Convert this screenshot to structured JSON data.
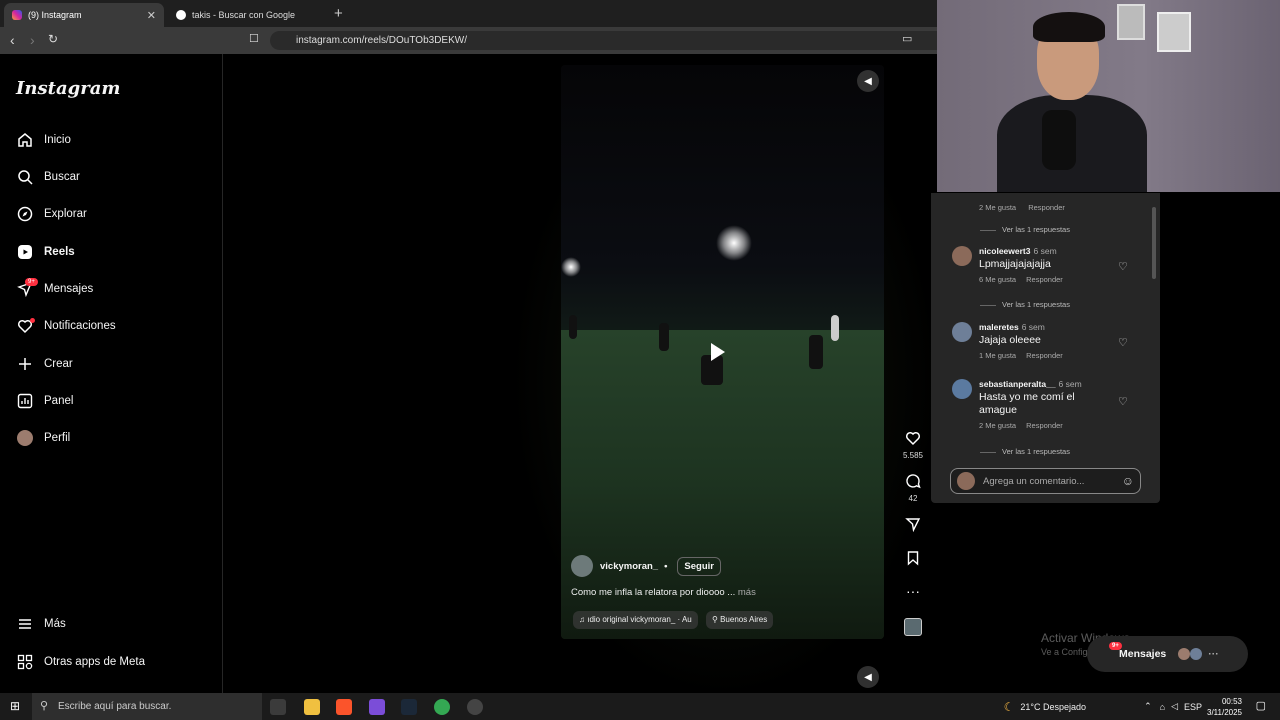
{
  "browser": {
    "tabs": [
      {
        "label": "(9) Instagram",
        "close": "✕"
      },
      {
        "label": "takis - Buscar con Google",
        "close": "✕"
      }
    ],
    "new_tab": "+",
    "url": "instagram.com/reels/DOuTOb3DEKW/"
  },
  "sidebar": {
    "logo": "Instagram",
    "items": [
      {
        "label": "Inicio",
        "icon": "home-icon"
      },
      {
        "label": "Buscar",
        "icon": "search-icon"
      },
      {
        "label": "Explorar",
        "icon": "compass-icon"
      },
      {
        "label": "Reels",
        "icon": "reels-icon"
      },
      {
        "label": "Mensajes",
        "icon": "messenger-icon",
        "badge": "9+"
      },
      {
        "label": "Notificaciones",
        "icon": "heart-icon"
      },
      {
        "label": "Crear",
        "icon": "plus-icon"
      },
      {
        "label": "Panel",
        "icon": "chart-icon"
      },
      {
        "label": "Perfil",
        "icon": "avatar-icon"
      }
    ],
    "more": "Más",
    "meta_apps": "Otras apps de Meta"
  },
  "reel": {
    "username": "vickymoran_",
    "separator": "•",
    "follow": "Seguir",
    "caption": "Como me infla la relatora por dioooo ...",
    "caption_more": "más",
    "audio": "ıdio original  vickymoran_ · Au",
    "location": "Buenos Aires",
    "likes": "5.585",
    "comments_count": "42"
  },
  "comments": {
    "top_meta": {
      "likes": "2 Me gusta",
      "reply": "Responder",
      "view_replies": "Ver las 1 respuestas"
    },
    "items": [
      {
        "username": "nicoleewert3",
        "time": "6 sem",
        "text": "Lpmajjajajajajja",
        "likes": "6 Me gusta",
        "reply": "Responder",
        "view_replies": "Ver las 1 respuestas"
      },
      {
        "username": "maleretes",
        "time": "6 sem",
        "text": "Jajaja oleeee",
        "likes": "1 Me gusta",
        "reply": "Responder"
      },
      {
        "username": "sebastianperalta__",
        "time": "6 sem",
        "text": "Hasta yo me comí el amague",
        "likes": "2 Me gusta",
        "reply": "Responder",
        "view_replies": "Ver las 1 respuestas"
      }
    ],
    "placeholder": "Agrega un comentario..."
  },
  "overlay": {
    "watermark_title": "Activar Windows",
    "watermark_sub": "Ve a Configuración para activar Windows.",
    "messages_pill": "Mensajes",
    "messages_badge": "9+"
  },
  "taskbar": {
    "search_placeholder": "Escribe aquí para buscar.",
    "weather": "21°C  Despejado",
    "lang": "ESP",
    "time": "00:53",
    "date": "3/11/2025"
  }
}
